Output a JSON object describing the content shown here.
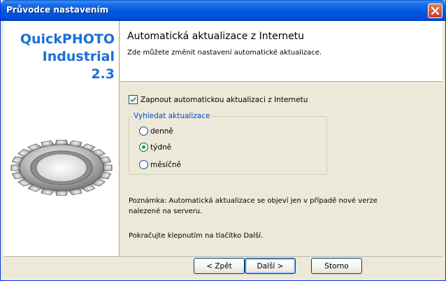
{
  "window": {
    "title": "Průvodce nastavením",
    "close_icon": "close-icon"
  },
  "branding": {
    "line1": "QuickPHOTO",
    "line2": "Industrial",
    "line3": "2.3",
    "icon": "gear-icon",
    "color": "#1a6fd6"
  },
  "header": {
    "title": "Automatická aktualizace z Internetu",
    "subtitle": "Zde můžete změnit nastavení automatické aktualizace."
  },
  "options": {
    "auto_update_label": "Zapnout automatickou aktualizaci z Internetu",
    "auto_update_checked": true,
    "group_label": "Vyhledat aktualizace",
    "frequencies": [
      {
        "label": "denně",
        "selected": false
      },
      {
        "label": "týdně",
        "selected": true
      },
      {
        "label": "měsíčně",
        "selected": false
      }
    ]
  },
  "note": "Poznámka: Automatická aktualizace se objeví jen v případě nové verze nalezené na serveru.",
  "continue_text": "Pokračujte klepnutím na tlačítko Další.",
  "buttons": {
    "back": "< Zpět",
    "next": "Další >",
    "cancel": "Storno"
  }
}
